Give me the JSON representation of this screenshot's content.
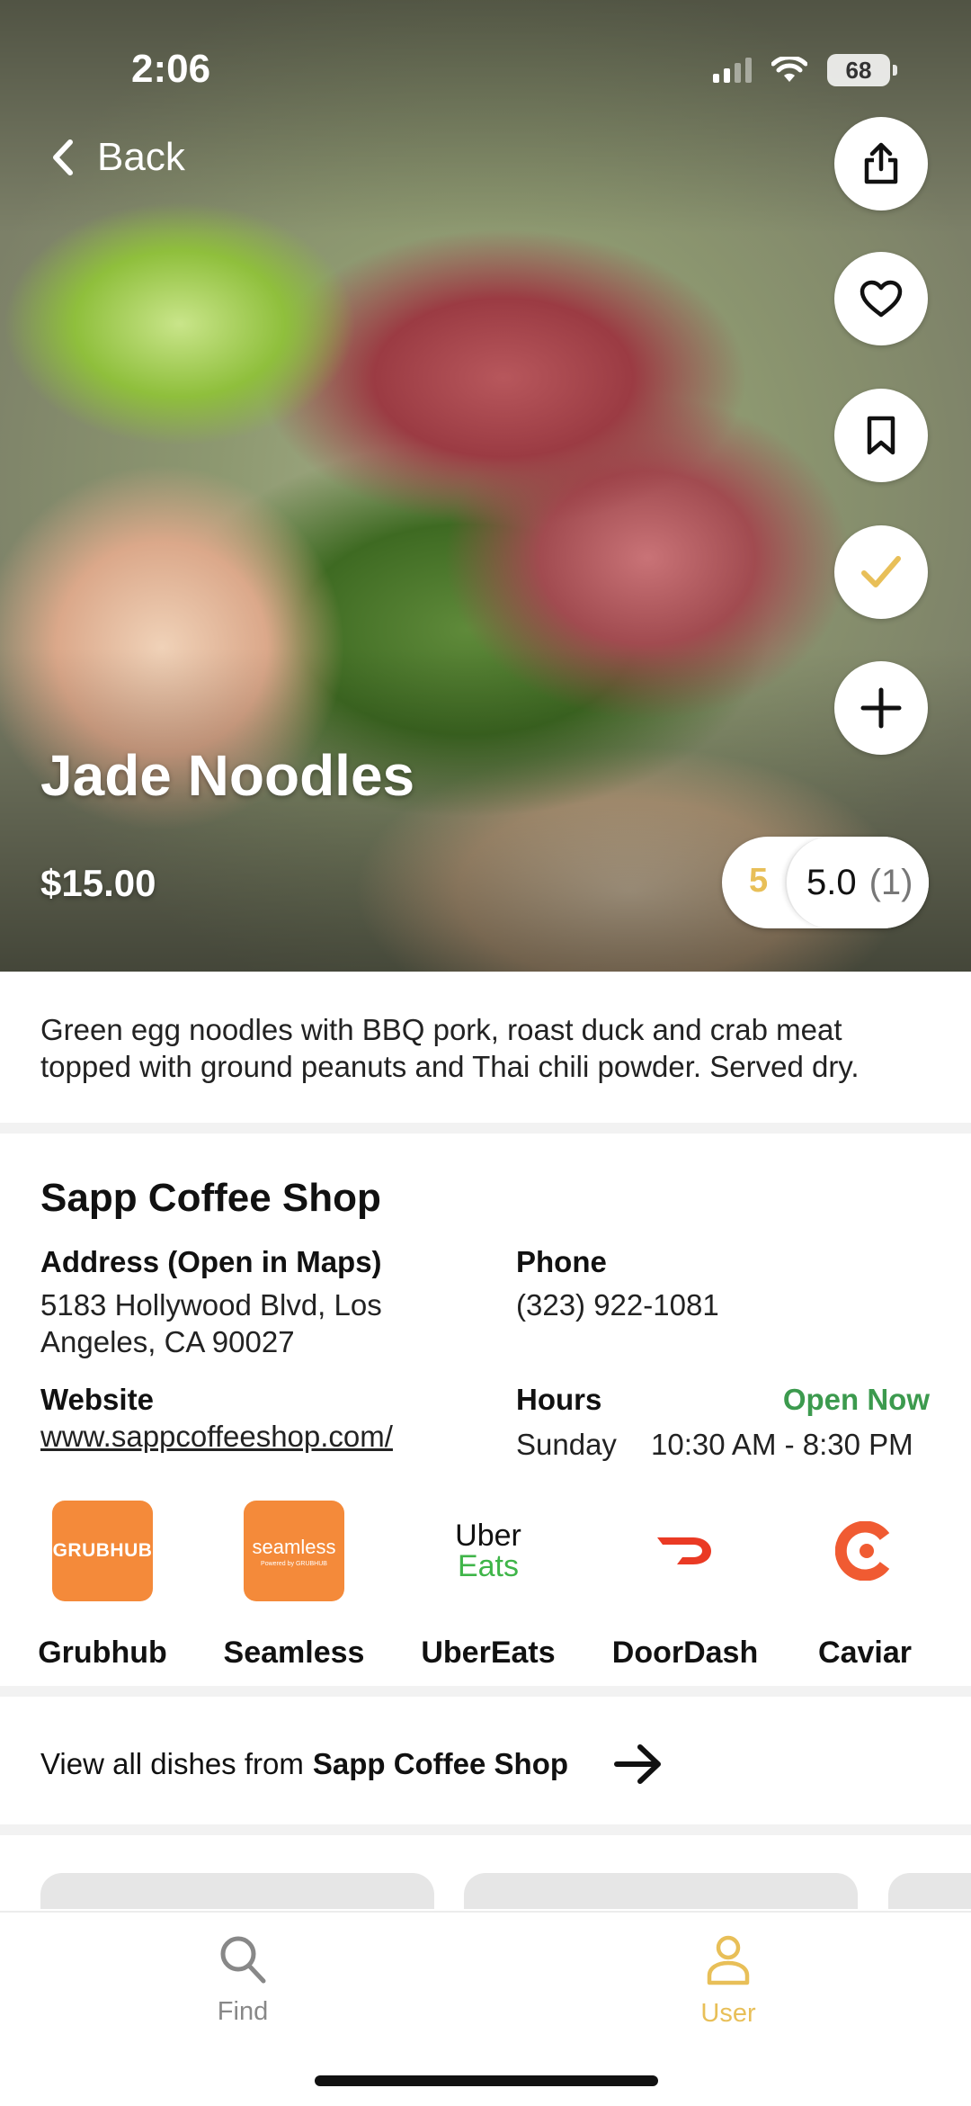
{
  "status_bar": {
    "time": "2:06",
    "battery": "68"
  },
  "nav": {
    "back_label": "Back"
  },
  "actions": {
    "icons": [
      "share-icon",
      "heart-icon",
      "bookmark-icon",
      "checkmark-icon",
      "plus-icon"
    ]
  },
  "dish": {
    "name": "Jade Noodles",
    "price": "$15.00",
    "my_rating": "5",
    "avg_rating": "5.0",
    "rating_count": "(1)",
    "description": "Green egg noodles with BBQ pork, roast duck and crab meat topped with ground peanuts and Thai chili powder. Served dry."
  },
  "restaurant": {
    "name": "Sapp Coffee Shop",
    "address_label": "Address (Open in Maps)",
    "address_line1": "5183 Hollywood Blvd, Los",
    "address_line2": "Angeles, CA 90027",
    "phone_label": "Phone",
    "phone": "(323) 922-1081",
    "website_label": "Website",
    "website": "www.sappcoffeeshop.com/",
    "hours_label": "Hours",
    "open_status": "Open Now",
    "hours_day": "Sunday",
    "hours_time": "10:30 AM - 8:30 PM"
  },
  "delivery": [
    {
      "name": "Grubhub",
      "logo_text": "GRUBHUB",
      "color": "#f48a3a"
    },
    {
      "name": "Seamless",
      "logo_text": "seamless",
      "logo_subtext": "Powered by GRUBHUB",
      "color": "#f48a3a"
    },
    {
      "name": "UberEats",
      "logo_text_top": "Uber",
      "logo_text_bottom": "Eats",
      "color": "#3fb549"
    },
    {
      "name": "DoorDash",
      "color": "#ea3a24"
    },
    {
      "name": "Caviar",
      "color": "#f05b32"
    }
  ],
  "view_all": {
    "prefix": "View all dishes from",
    "restaurant": "Sapp Coffee Shop"
  },
  "tabs": [
    {
      "label": "Find",
      "icon": "search-icon",
      "color": "#888888"
    },
    {
      "label": "User",
      "icon": "user-icon",
      "color": "#e8bf58"
    }
  ],
  "colors": {
    "accent": "#e8bf58",
    "open": "#3c9a4e"
  }
}
